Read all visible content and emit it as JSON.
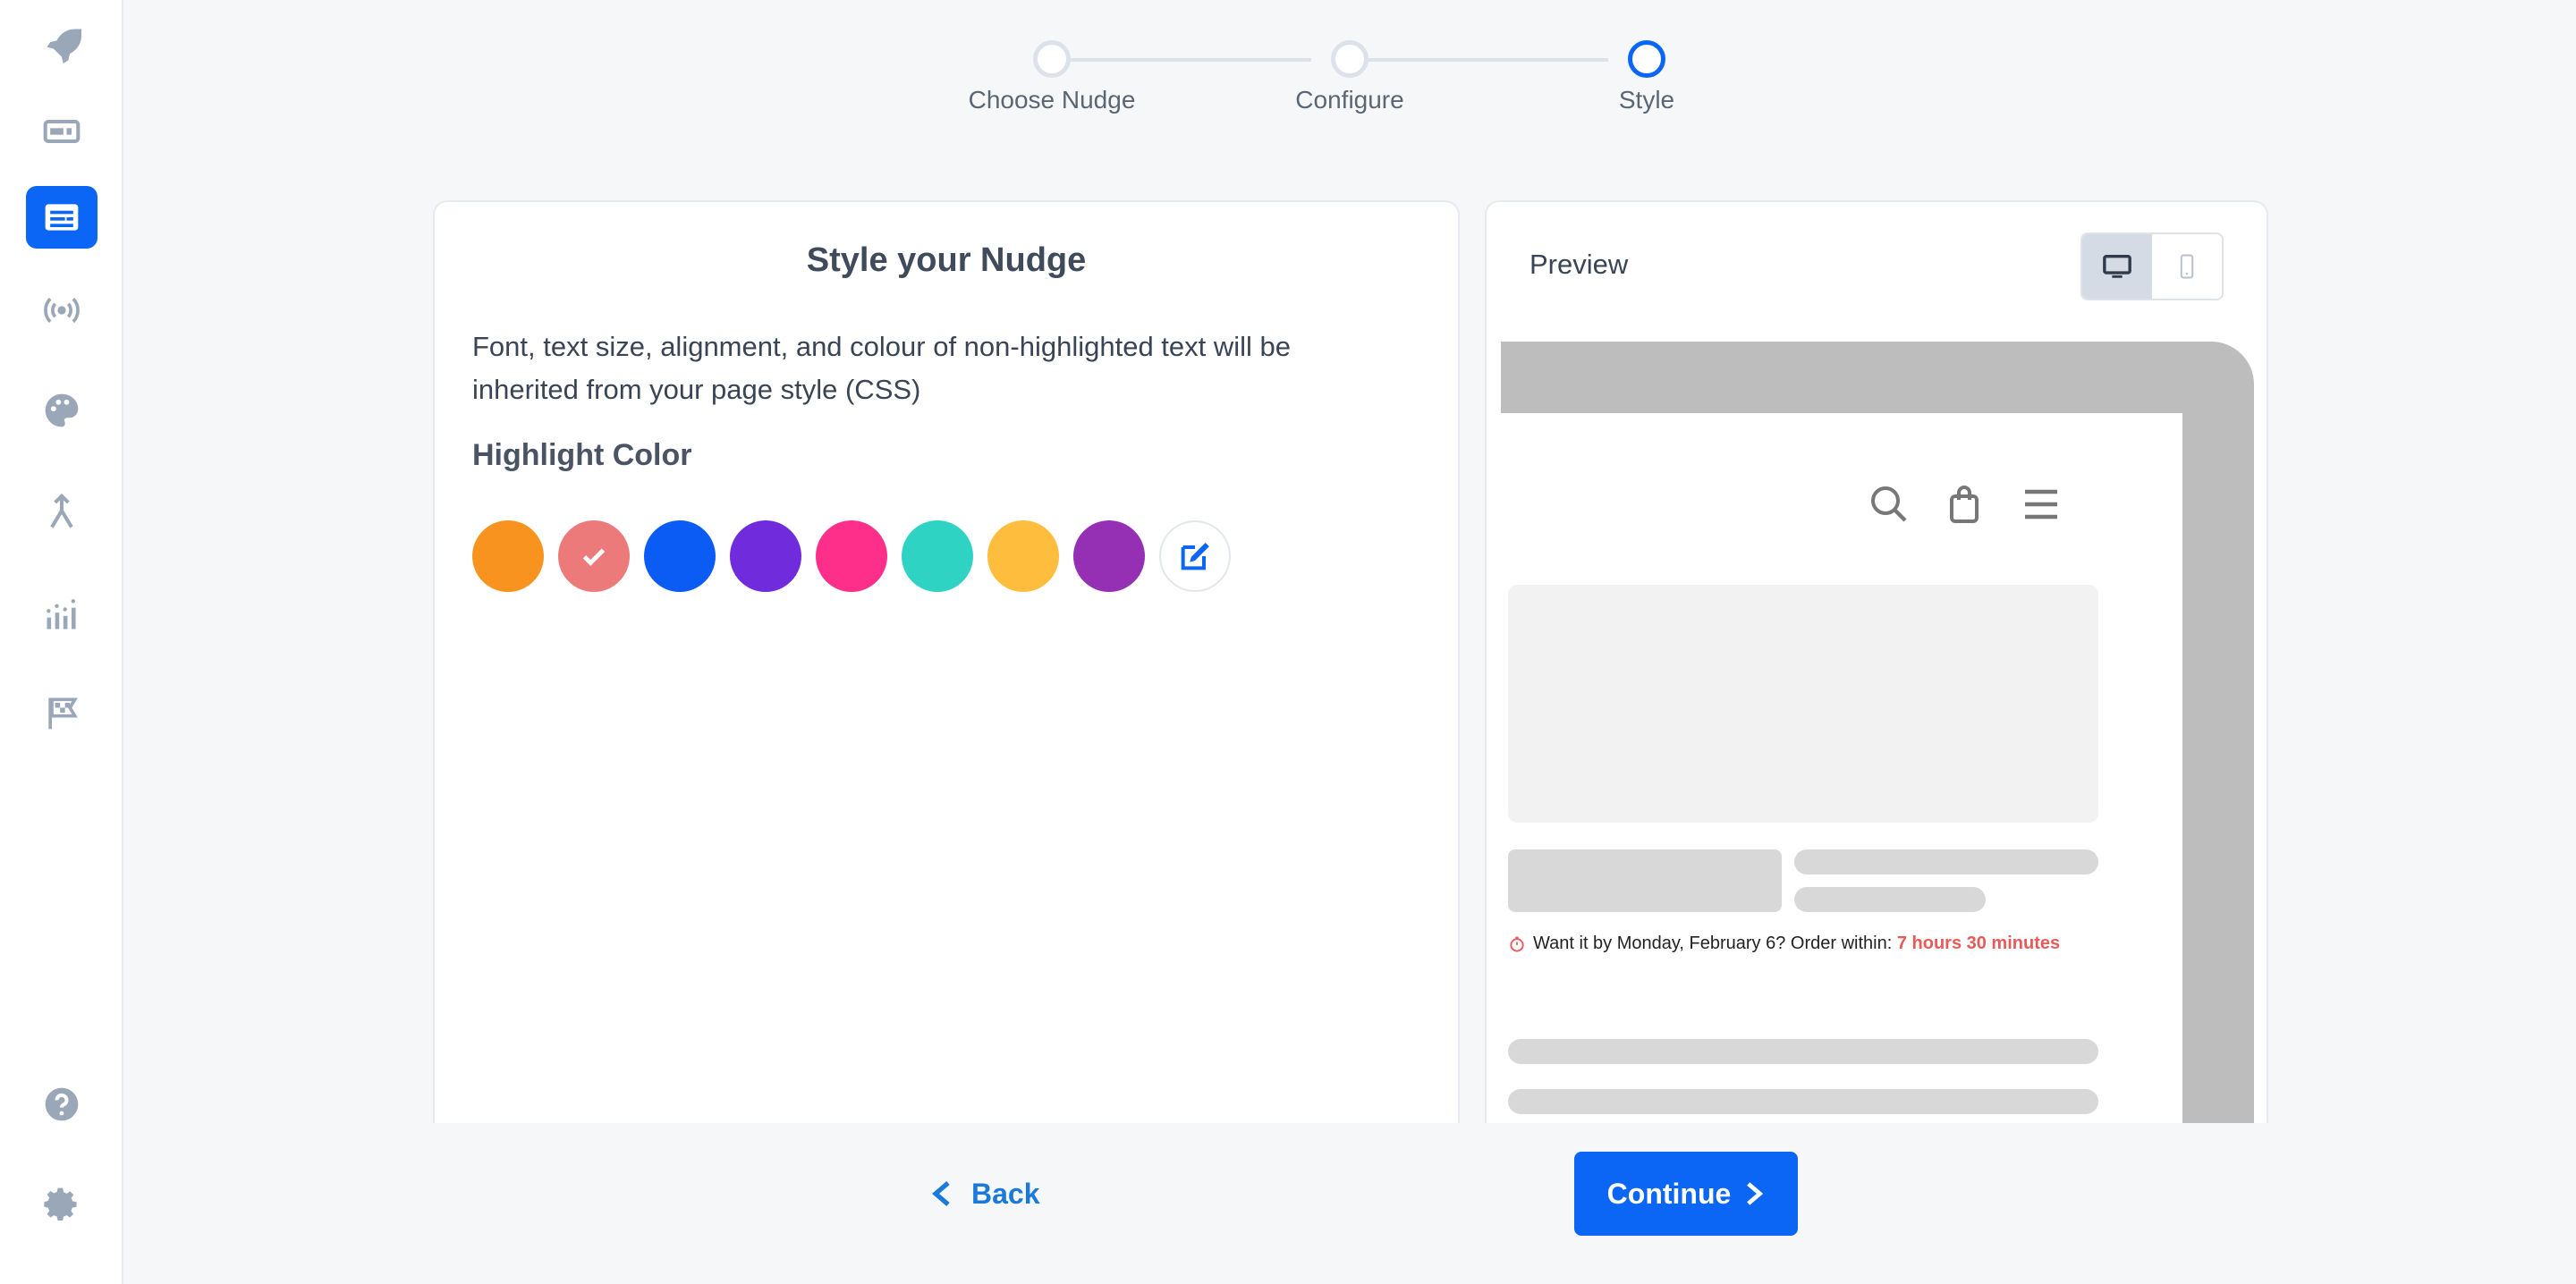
{
  "sidebar": {
    "items": [
      {
        "icon": "rocket-icon"
      },
      {
        "icon": "card-icon"
      },
      {
        "icon": "nudge-icon",
        "active": true
      },
      {
        "icon": "broadcast-icon"
      },
      {
        "icon": "palette-icon"
      },
      {
        "icon": "merge-icon"
      },
      {
        "icon": "analytics-icon"
      },
      {
        "icon": "flag-icon"
      }
    ],
    "bottom": [
      {
        "icon": "help-icon"
      },
      {
        "icon": "gear-icon"
      }
    ]
  },
  "stepper": {
    "steps": [
      {
        "label": "Choose Nudge"
      },
      {
        "label": "Configure"
      },
      {
        "label": "Style",
        "current": true
      }
    ]
  },
  "style_card": {
    "title": "Style your Nudge",
    "description": "Font, text size, alignment, and colour of non-highlighted text will be inherited from your page style (CSS)",
    "highlight_title": "Highlight Color",
    "swatches": [
      "#f7931e",
      "#ec7a7a",
      "#0b5cf5",
      "#6f2bdc",
      "#fd2f8b",
      "#2ed3c4",
      "#ffbd3e",
      "#9530b4"
    ],
    "selected_swatch": 1
  },
  "preview": {
    "title": "Preview",
    "device_selected": "desktop",
    "nudge_text": "Want it by Monday, February 6? Order within: ",
    "nudge_highlight": "7 hours 30 minutes",
    "highlight_color": "#e85a5a"
  },
  "footer": {
    "back_label": "Back",
    "continue_label": "Continue"
  },
  "colors": {
    "accent": "#0b66f5",
    "link": "#1a7ad9",
    "sidebar_icon": "#9aa7b8"
  }
}
